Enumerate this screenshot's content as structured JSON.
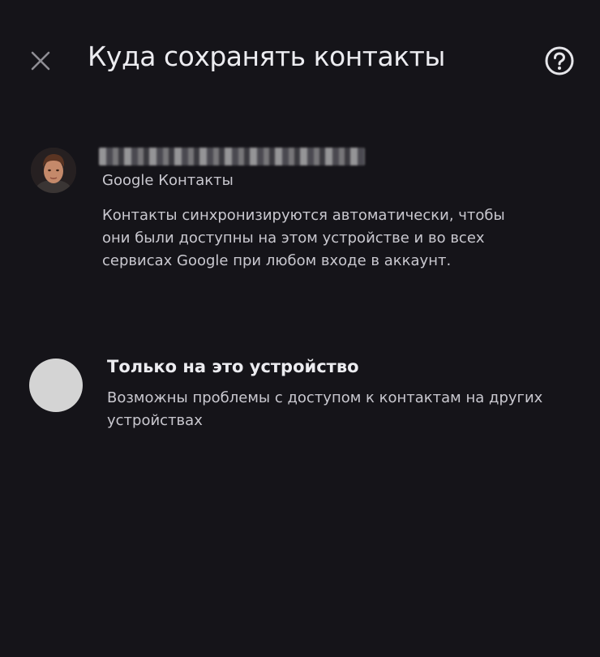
{
  "header": {
    "title": "Куда сохранять контакты",
    "close_icon": "close-icon",
    "help_icon": "help-circle-icon"
  },
  "options": {
    "account": {
      "avatar_icon": "user-avatar",
      "email": "",
      "service": "Google Контакты",
      "description": "Контакты синхронизируются автоматически, чтобы они были доступны на этом устройстве и во всех сервисах Google при любом входе в аккаунт."
    },
    "device": {
      "icon": "device-icon",
      "title": "Только на это устройство",
      "description": "Возможны проблемы с доступом к контактам на других устройствах"
    }
  },
  "colors": {
    "background": "#151419",
    "text_primary": "#ececf0",
    "text_secondary": "#c9c8cf",
    "device_icon_bg": "#d4d4d4"
  }
}
